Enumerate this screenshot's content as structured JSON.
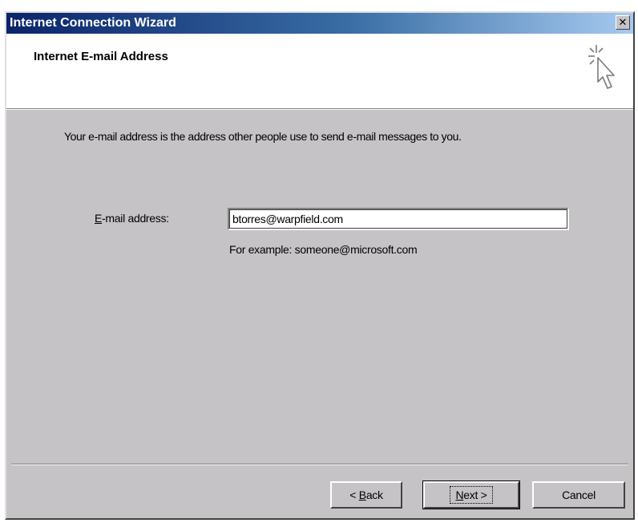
{
  "window": {
    "title": "Internet Connection Wizard",
    "close_glyph": "✕"
  },
  "header": {
    "title": "Internet E-mail Address",
    "icon": "wizard-cursor-icon"
  },
  "body": {
    "description": "Your e-mail address is the address other people use to send e-mail messages to you.",
    "email_label_accel": "E",
    "email_label_rest": "-mail address:",
    "email_value": "btorres@warpfield.com",
    "example": "For example: someone@microsoft.com"
  },
  "buttons": {
    "back_prefix": "< ",
    "back_accel": "B",
    "back_rest": "ack",
    "next_accel": "N",
    "next_rest": "ext >",
    "cancel": "Cancel"
  },
  "colors": {
    "title_bar": "#0a246a",
    "dialog_face": "#c6c3c6",
    "header_bg": "#ffffff"
  }
}
